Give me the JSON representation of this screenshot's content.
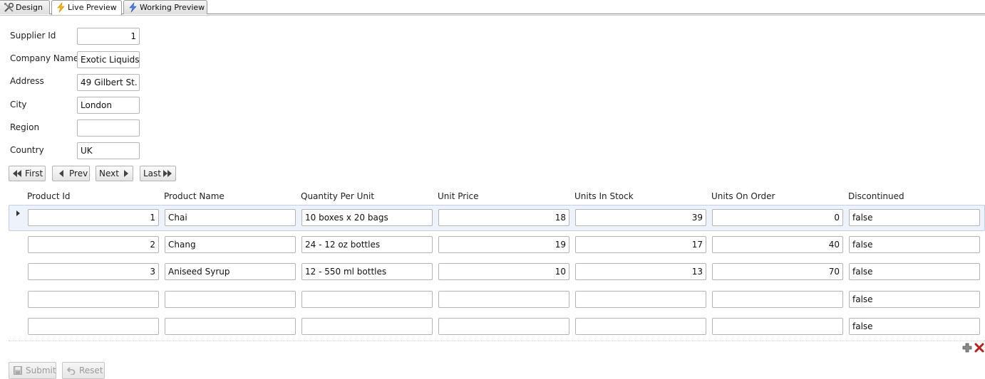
{
  "tabs": [
    {
      "label": "Design",
      "icon": "tools-icon"
    },
    {
      "label": "Live Preview",
      "icon": "lightning-icon"
    },
    {
      "label": "Working Preview",
      "icon": "lightning-icon"
    }
  ],
  "form": {
    "supplier_id": {
      "label": "Supplier Id",
      "value": "1"
    },
    "company_name": {
      "label": "Company Name",
      "value": "Exotic Liquids"
    },
    "address": {
      "label": "Address",
      "value": "49 Gilbert St."
    },
    "city": {
      "label": "City",
      "value": "London"
    },
    "region": {
      "label": "Region",
      "value": ""
    },
    "country": {
      "label": "Country",
      "value": "UK"
    }
  },
  "nav": {
    "first": "First",
    "prev": "Prev",
    "next": "Next",
    "last": "Last"
  },
  "grid": {
    "columns": [
      "Product Id",
      "Product Name",
      "Quantity Per Unit",
      "Unit Price",
      "Units In Stock",
      "Units On Order",
      "Discontinued"
    ],
    "rows": [
      [
        "1",
        "Chai",
        "10 boxes x 20 bags",
        "18",
        "39",
        "0",
        "false"
      ],
      [
        "2",
        "Chang",
        "24 - 12 oz bottles",
        "19",
        "17",
        "40",
        "false"
      ],
      [
        "3",
        "Aniseed Syrup",
        "12 - 550 ml bottles",
        "10",
        "13",
        "70",
        "false"
      ],
      [
        "",
        "",
        "",
        "",
        "",
        "",
        "false"
      ],
      [
        "",
        "",
        "",
        "",
        "",
        "",
        "false"
      ]
    ],
    "selected_row": 0
  },
  "actions": {
    "submit": "Submit",
    "reset": "Reset"
  },
  "colors": {
    "selection_bg": "#eef2fb",
    "selection_border": "#c3cde6",
    "delete_red": "#b22222"
  }
}
